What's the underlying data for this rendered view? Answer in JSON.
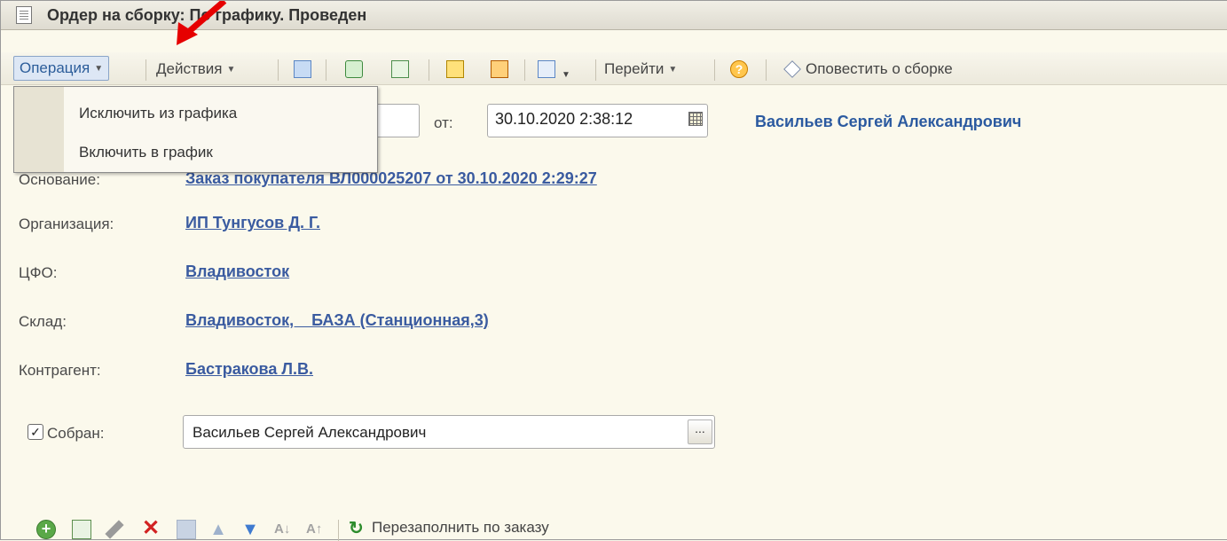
{
  "window": {
    "title": "Ордер на сборку: По графику. Проведен"
  },
  "toolbar": {
    "operation_label": "Операция",
    "actions_label": "Действия",
    "goto_label": "Перейти",
    "notify_label": "Оповестить о сборке"
  },
  "operation_menu": {
    "items": [
      "Исключить из графика",
      "Включить в график"
    ]
  },
  "header": {
    "date_label": "от:",
    "date_value": "30.10.2020  2:38:12",
    "responsible": "Васильев Сергей Александрович"
  },
  "fields": {
    "basis_label": "Основание:",
    "basis_value": "Заказ покупателя ВЛ000025207 от 30.10.2020 2:29:27",
    "organization_label": "Организация:",
    "organization_value": "ИП Тунгусов Д. Г.",
    "cfo_label": "ЦФО:",
    "cfo_value": "Владивосток",
    "warehouse_label": "Склад:",
    "warehouse_value": "Владивосток,    БАЗА (Станционная,3)",
    "counterparty_label": "Контрагент:",
    "counterparty_value": "Бастракова Л.В.",
    "collected_label": "Собран:",
    "collected_checked": true,
    "collected_by": "Васильев Сергей Александрович",
    "ellipsis": "..."
  },
  "table_toolbar": {
    "refill_label": "Перезаполнить по заказу"
  },
  "colors": {
    "background": "#fbf9ec",
    "link": "#3a5ba0",
    "accent_arrow": "#e60000"
  }
}
